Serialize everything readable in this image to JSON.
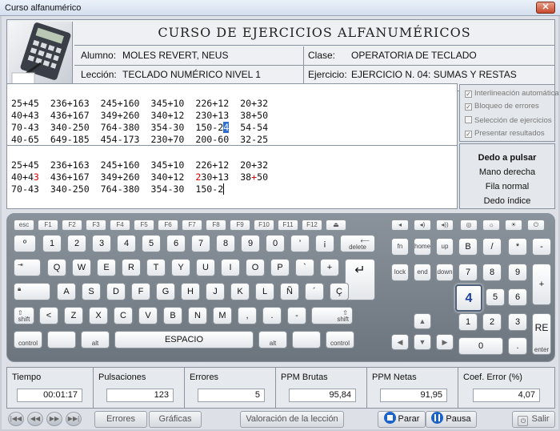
{
  "window": {
    "title": "Curso alfanumérico",
    "close": "✕"
  },
  "header": {
    "title": "CURSO DE EJERCICIOS ALFANUMÉRICOS",
    "alumno_label": "Alumno:",
    "alumno": "MOLES REVERT, NEUS",
    "clase_label": "Clase:",
    "clase": "OPERATORIA DE TECLADO",
    "leccion_label": "Lección:",
    "leccion": "TECLADO NUMÉRICO NIVEL 1",
    "ejercicio_label": "Ejercicio:",
    "ejercicio": "EJERCICIO N. 04: SUMAS Y RESTAS"
  },
  "model_text": {
    "line1": "25+45  236+163  245+160  345+10  226+12  20+32",
    "line2": "40+43  436+167  349+260  340+12  230+13  38+50",
    "line3_before": "70-43  340-250  764-380  354-30  150-2",
    "line3_cursor": "4",
    "line3_after": "  54-54",
    "line4": "40-65  649-185  454-173  230+70  200-60  32-25"
  },
  "typed_text": {
    "line1": "25+45  236+163  245+160  345+10  226+12  20+32",
    "line2_a": "40+4",
    "line2_err1": "3",
    "line2_b": "  436+167  349+260  340+12  ",
    "line2_err2": "2",
    "line2_c": "30+13  38",
    "line2_err3": "+",
    "line2_d": "50",
    "line3": "70-43  340-250  764-380  354-30  150-2"
  },
  "options": [
    {
      "label": "Interlineación automática",
      "checked": true
    },
    {
      "label": "Bloqueo de errores",
      "checked": true
    },
    {
      "label": "Selección de ejercicios",
      "checked": false
    },
    {
      "label": "Presentar resultados",
      "checked": true
    }
  ],
  "dedo": {
    "title": "Dedo a pulsar",
    "mano": "Mano derecha",
    "fila": "Fila normal",
    "dedo": "Dedo índice"
  },
  "keyboard": {
    "esc": "esc",
    "f": [
      "F1",
      "F2",
      "F3",
      "F4",
      "F5",
      "F6",
      "F7",
      "F8",
      "F9",
      "F10",
      "F11",
      "F12"
    ],
    "row1": [
      "º",
      "1",
      "2",
      "3",
      "4",
      "5",
      "6",
      "7",
      "8",
      "9",
      "0",
      "'",
      "¡"
    ],
    "delete": "delete",
    "row2": [
      "Q",
      "W",
      "E",
      "R",
      "T",
      "Y",
      "U",
      "I",
      "O",
      "P",
      "`",
      "+"
    ],
    "row3": [
      "A",
      "S",
      "D",
      "F",
      "G",
      "H",
      "J",
      "K",
      "L",
      "Ñ",
      "´",
      "Ç"
    ],
    "row4": [
      "<",
      "Z",
      "X",
      "C",
      "V",
      "B",
      "N",
      "M",
      ",",
      ".",
      "-"
    ],
    "shift": "shift",
    "control": "control",
    "alt": "alt",
    "espacio": "ESPACIO",
    "nav1": [
      "fn",
      "home",
      "up"
    ],
    "nav2": [
      "lock",
      "end",
      "down"
    ],
    "num": [
      "B",
      "/",
      "*",
      "-",
      "7",
      "8",
      "9",
      "+",
      "4",
      "5",
      "6",
      "1",
      "2",
      "3",
      "0",
      ".",
      ""
    ],
    "highlight": "4",
    "re": "RE",
    "enter": "enter"
  },
  "stats": {
    "tiempo_label": "Tiempo",
    "tiempo": "00:01:17",
    "puls_label": "Pulsaciones",
    "puls": "123",
    "err_label": "Errores",
    "err": "5",
    "ppmb_label": "PPM Brutas",
    "ppmb": "95,84",
    "ppmn_label": "PPM Netas",
    "ppmn": "91,95",
    "coef_label": "Coef. Error (%)",
    "coef": "4,07"
  },
  "bottom": {
    "errores": "Errores",
    "graficas": "Gráficas",
    "valoracion": "Valoración de la lección",
    "parar": "Parar",
    "pausa": "Pausa",
    "salir": "Salir"
  }
}
